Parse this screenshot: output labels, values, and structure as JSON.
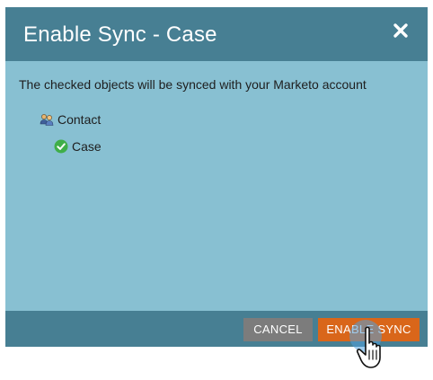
{
  "dialog": {
    "title": "Enable Sync - Case",
    "close_icon": "close-icon",
    "message": "The checked objects will be synced with your Marketo account",
    "tree": [
      {
        "label": "Contact",
        "icon": "contacts-icon",
        "level": 0
      },
      {
        "label": "Case",
        "icon": "green-check-icon",
        "level": 1
      }
    ],
    "buttons": {
      "cancel_label": "CANCEL",
      "enable_label": "ENABLE SYNC"
    }
  },
  "colors": {
    "header_bg": "#477f93",
    "body_bg": "#88c0d2",
    "cancel_bg": "#7c7c7c",
    "enable_bg": "#d9661a"
  },
  "cursor": {
    "icon": "hand-pointer-icon"
  }
}
